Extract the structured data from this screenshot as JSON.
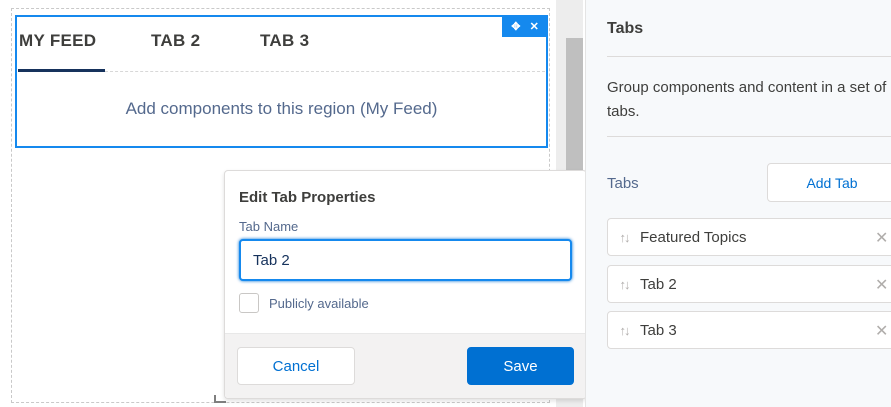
{
  "canvas": {
    "tabs": [
      {
        "label": "MY FEED"
      },
      {
        "label": "TAB 2"
      },
      {
        "label": "TAB 3"
      }
    ],
    "region_placeholder": "Add components to this region (My Feed)",
    "actions": {
      "move_icon": "move-icon",
      "remove_icon": "close-icon"
    }
  },
  "popover": {
    "title": "Edit Tab Properties",
    "tab_name_label": "Tab Name",
    "tab_name_value": "Tab 2",
    "publicly_available_label": "Publicly available",
    "publicly_available_checked": false,
    "cancel_label": "Cancel",
    "save_label": "Save"
  },
  "panel": {
    "title": "Tabs",
    "description": "Group components and content in a set of tabs.",
    "tabs_label": "Tabs",
    "add_tab_label": "Add Tab",
    "tab_items": [
      {
        "label": "Featured Topics"
      },
      {
        "label": "Tab 2"
      },
      {
        "label": "Tab 3"
      }
    ]
  },
  "colors": {
    "accent": "#1589ee",
    "brand": "#0070d2",
    "active_tab_underline": "#16325c"
  }
}
